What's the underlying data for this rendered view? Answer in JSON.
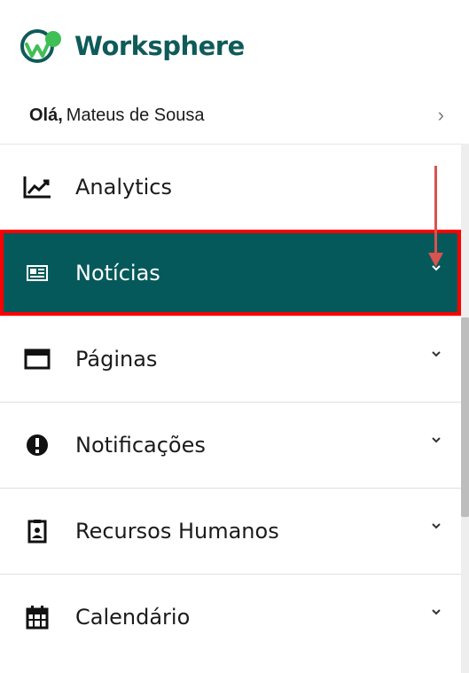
{
  "brand": {
    "name": "Worksphere",
    "accent": "#0f5b59"
  },
  "user": {
    "greeting": "Olá,",
    "name": "Mateus de Sousa"
  },
  "nav": {
    "items": [
      {
        "label": "Analytics",
        "icon": "chart-line-icon",
        "active": false,
        "expandable": false
      },
      {
        "label": "Notícias",
        "icon": "newspaper-icon",
        "active": true,
        "expandable": true
      },
      {
        "label": "Páginas",
        "icon": "window-icon",
        "active": false,
        "expandable": true
      },
      {
        "label": "Notificações",
        "icon": "alert-icon",
        "active": false,
        "expandable": true
      },
      {
        "label": "Recursos Humanos",
        "icon": "id-badge-icon",
        "active": false,
        "expandable": true
      },
      {
        "label": "Calendário",
        "icon": "calendar-icon",
        "active": false,
        "expandable": true
      }
    ]
  },
  "colors": {
    "active_bg": "#06595a",
    "highlight": "#ff0000",
    "annotation_arrow": "#d9534f"
  }
}
